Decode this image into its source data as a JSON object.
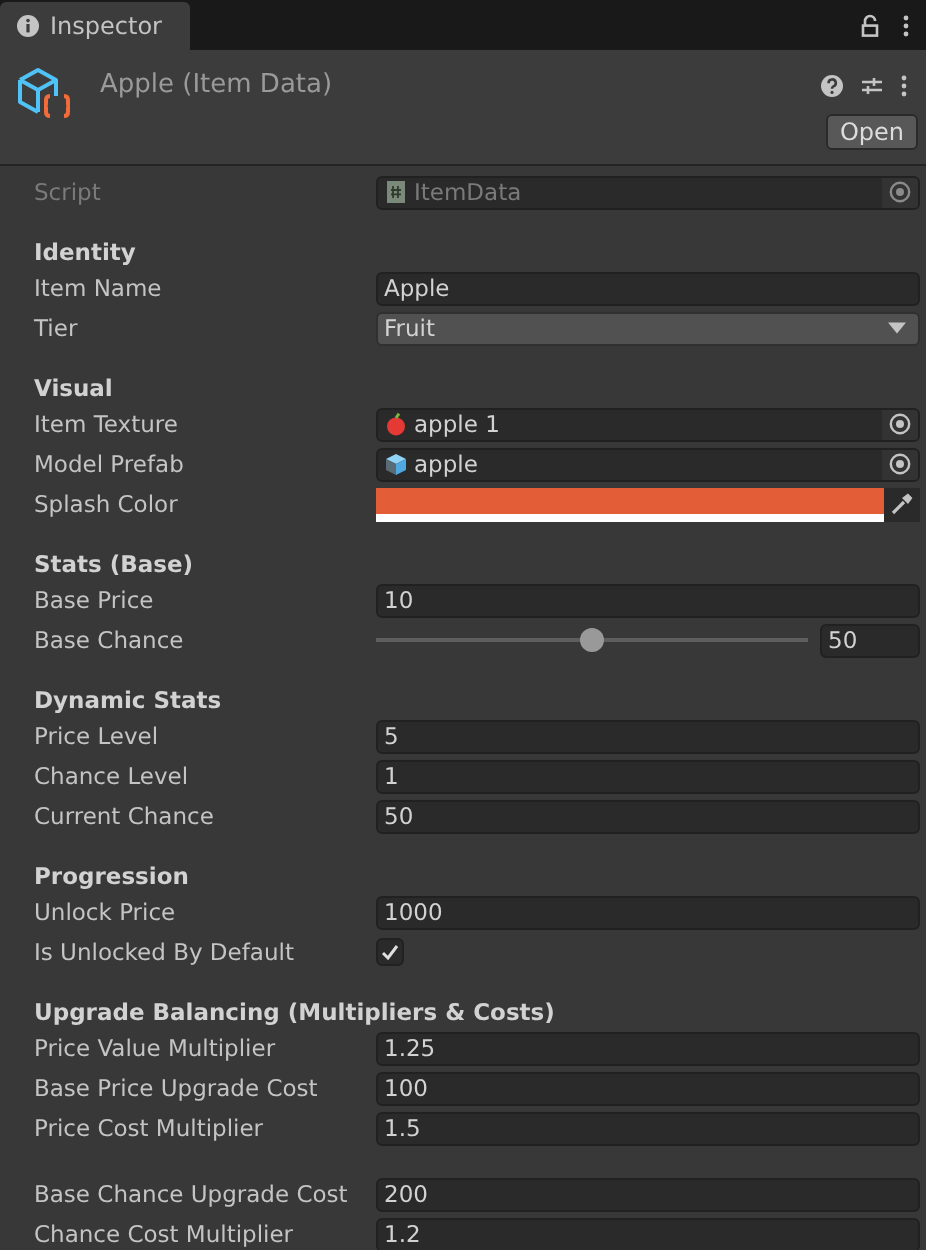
{
  "tab": {
    "label": "Inspector",
    "selected": true
  },
  "header": {
    "title": "Apple (Item Data)",
    "button": "Open"
  },
  "script": {
    "label": "Script",
    "value": "ItemData",
    "disabled": true
  },
  "sections": [
    {
      "title": "Identity",
      "fields": [
        {
          "kind": "text",
          "label": "Item Name",
          "value": "Apple"
        },
        {
          "kind": "dropdown",
          "label": "Tier",
          "value": "Fruit"
        }
      ]
    },
    {
      "title": "Visual",
      "fields": [
        {
          "kind": "texture",
          "label": "Item Texture",
          "value": "apple 1"
        },
        {
          "kind": "prefab",
          "label": "Model Prefab",
          "value": "apple"
        },
        {
          "kind": "color",
          "label": "Splash Color",
          "color": "#e35d36"
        }
      ]
    },
    {
      "title": "Stats (Base)",
      "fields": [
        {
          "kind": "text",
          "label": "Base Price",
          "value": "10"
        },
        {
          "kind": "slider",
          "label": "Base Chance",
          "level": 0.5,
          "value": "50"
        }
      ]
    },
    {
      "title": "Dynamic Stats",
      "fields": [
        {
          "kind": "text",
          "label": "Price Level",
          "value": "5"
        },
        {
          "kind": "text",
          "label": "Chance Level",
          "value": "1"
        },
        {
          "kind": "text",
          "label": "Current Chance",
          "value": "50"
        }
      ]
    },
    {
      "title": "Progression",
      "fields": [
        {
          "kind": "text",
          "label": "Unlock Price",
          "value": "1000"
        },
        {
          "kind": "checkbox",
          "label": "Is Unlocked By Default",
          "checked": true
        }
      ]
    },
    {
      "title": "Upgrade Balancing (Multipliers & Costs)",
      "fields": [
        {
          "kind": "text",
          "label": "Price Value Multiplier",
          "value": "1.25"
        },
        {
          "kind": "text",
          "label": "Base Price Upgrade Cost",
          "value": "100"
        },
        {
          "kind": "text",
          "label": "Price Cost Multiplier",
          "value": "1.5"
        }
      ]
    },
    {
      "fields": [
        {
          "kind": "text",
          "label": "Base Chance Upgrade Cost",
          "value": "200"
        },
        {
          "kind": "text",
          "label": "Chance Cost Multiplier",
          "value": "1.2"
        }
      ]
    }
  ]
}
